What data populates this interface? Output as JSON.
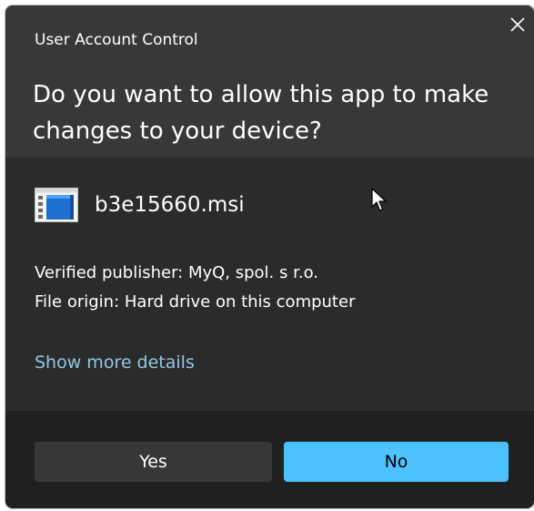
{
  "dialog": {
    "title": "User Account Control",
    "question": "Do you want to allow this app to make changes to your device?",
    "file_name": "b3e15660.msi",
    "publisher_line": "Verified publisher: MyQ, spol. s r.o.",
    "origin_line": "File origin: Hard drive on this computer",
    "details_link": "Show more details",
    "yes_label": "Yes",
    "no_label": "No",
    "close_icon": "close-icon",
    "file_icon": "installer-file-icon"
  },
  "colors": {
    "header_bg": "#383838",
    "body_bg": "#2b2b2b",
    "footer_bg": "#202020",
    "link": "#8fc9e4",
    "accent": "#4cc2ff",
    "secondary_button": "#373737"
  }
}
